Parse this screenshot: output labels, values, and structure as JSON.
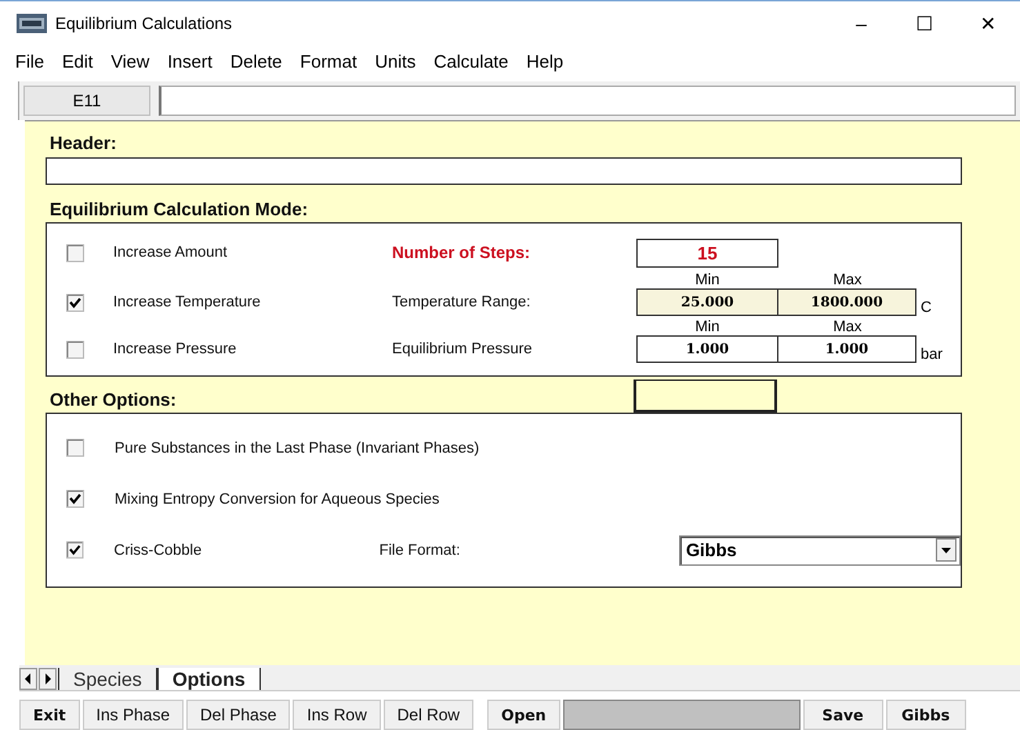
{
  "window": {
    "title": "Equilibrium Calculations",
    "controls": [
      "–",
      "☐",
      "✕"
    ]
  },
  "menu": [
    "File",
    "Edit",
    "View",
    "Insert",
    "Delete",
    "Format",
    "Units",
    "Calculate",
    "Help"
  ],
  "formula_bar": {
    "cell_ref": "E11"
  },
  "header": {
    "label": "Header:"
  },
  "mode": {
    "title": "Equilibrium Calculation Mode:",
    "rows": [
      {
        "label": "Increase Amount",
        "checked": false
      },
      {
        "label": "Increase Temperature",
        "checked": true
      },
      {
        "label": "Increase Pressure",
        "checked": false
      }
    ],
    "steps": {
      "label": "Number of Steps:",
      "value": "15"
    },
    "temperature": {
      "label": "Temperature Range:",
      "min_label": "Min",
      "max_label": "Max",
      "min": "25.000",
      "max": "1800.000",
      "unit": "C"
    },
    "pressure": {
      "label": "Equilibrium Pressure",
      "min_label": "Min",
      "max_label": "Max",
      "min": "1.000",
      "max": "1.000",
      "unit": "bar"
    }
  },
  "other": {
    "title": "Other Options:",
    "options": [
      {
        "label": "Pure Substances in the Last Phase (Invariant Phases)",
        "checked": false
      },
      {
        "label": "Mixing  Entropy Conversion for Aqueous Species",
        "checked": true
      },
      {
        "label": "Criss-Cobble",
        "checked": true
      }
    ],
    "file_format": {
      "label": "File Format:",
      "value": "Gibbs"
    }
  },
  "tabs": [
    {
      "label": "Species",
      "selected": false
    },
    {
      "label": "Options",
      "selected": true
    }
  ],
  "buttons": [
    {
      "label": "Exit",
      "bold": true
    },
    {
      "label": "Ins Phase",
      "bold": false
    },
    {
      "label": "Del Phase",
      "bold": false
    },
    {
      "label": "Ins Row",
      "bold": false
    },
    {
      "label": "Del Row",
      "bold": false
    },
    {
      "label": "Open",
      "bold": true
    }
  ],
  "right_buttons": [
    {
      "label": "Save",
      "bold": true
    },
    {
      "label": "Gibbs",
      "bold": true
    }
  ]
}
